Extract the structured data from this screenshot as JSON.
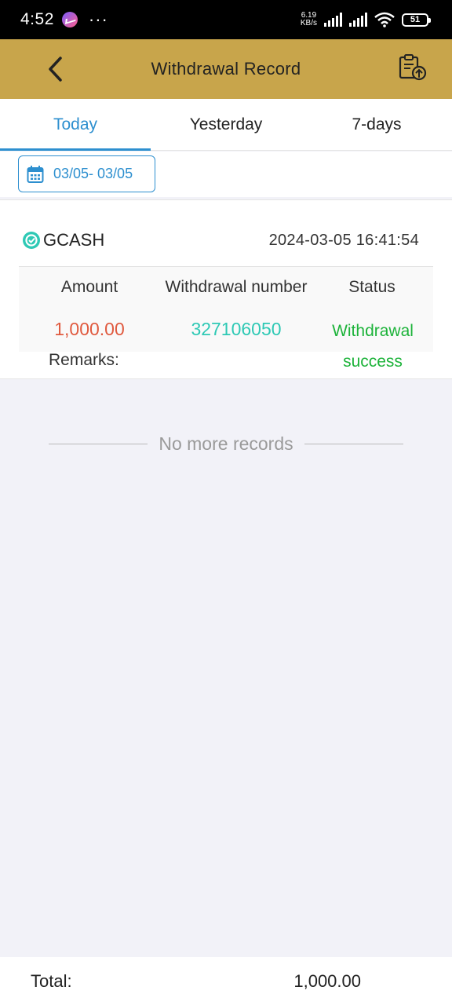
{
  "status_bar": {
    "time": "4:52",
    "more": "···",
    "speed_top": "6.19",
    "speed_bottom": "KB/s",
    "battery": "51"
  },
  "header": {
    "title": "Withdrawal Record",
    "back_icon": "chevron-left-icon",
    "action_icon": "clipboard-upload-icon",
    "background": "#c8a54b"
  },
  "tabs": [
    {
      "label": "Today",
      "active": true
    },
    {
      "label": "Yesterday",
      "active": false
    },
    {
      "label": "7-days",
      "active": false
    }
  ],
  "date_filter": {
    "icon": "calendar-icon",
    "range": "03/05- 03/05"
  },
  "records": [
    {
      "method": "GCASH",
      "datetime": "2024-03-05 16:41:54",
      "headers": {
        "amount": "Amount",
        "number": "Withdrawal number",
        "status": "Status"
      },
      "amount": "1,000.00",
      "number": "327106050",
      "status": "Withdrawal success",
      "remarks_label": "Remarks:"
    }
  ],
  "no_more": "No more records",
  "footer": {
    "total_label": "Total:",
    "total_value": "1,000.00"
  },
  "colors": {
    "accent": "#2d8fcf",
    "amount": "#e05a3f",
    "number": "#2ec9b5",
    "status_success": "#1db33a"
  }
}
